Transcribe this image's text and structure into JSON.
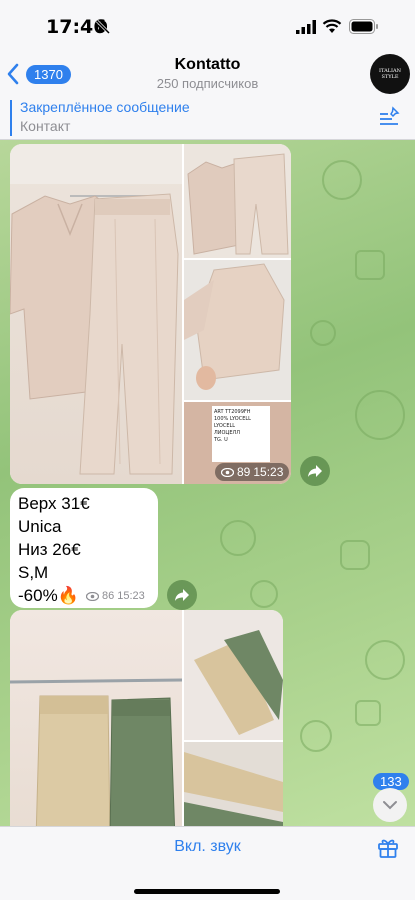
{
  "status_bar": {
    "time": "17:46"
  },
  "header": {
    "back_count": "1370",
    "title": "Kontatto",
    "subtitle": "250 подписчиков",
    "avatar_text": "ITALIAN STYLE"
  },
  "pinned": {
    "title": "Закреплённое сообщение",
    "text": "Контакт"
  },
  "album1": {
    "views": "89",
    "time": "15:23",
    "label_lines": [
      "ART TT2099FH",
      "100% LYOCELL",
      "LYOCELL",
      "ЛИОЦЕЛЛ",
      "TG. U"
    ]
  },
  "message": {
    "lines": [
      "Верх 31€",
      "Unica",
      "Низ 26€",
      "S,M",
      "-60%🔥"
    ],
    "views": "86",
    "time": "15:23"
  },
  "scroll": {
    "unread_count": "133"
  },
  "bottom": {
    "sound_label": "Вкл. звук"
  },
  "colors": {
    "accent": "#2f80ed",
    "chat_bg": "#a9d18c",
    "bubble": "#ffffff"
  }
}
